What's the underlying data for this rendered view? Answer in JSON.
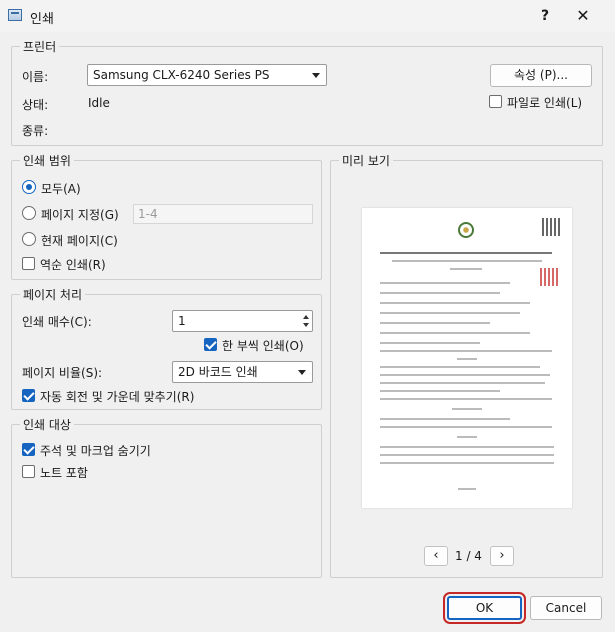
{
  "window": {
    "title": "인쇄",
    "help": "?",
    "close": "✕"
  },
  "printer": {
    "legend": "프린터",
    "name_label": "이름:",
    "name_value": "Samsung CLX-6240 Series PS",
    "status_label": "상태:",
    "status_value": "Idle",
    "type_label": "종류:",
    "properties_button": "속성 (P)...",
    "print_to_file": "파일로 인쇄(L)",
    "print_to_file_checked": false
  },
  "range": {
    "legend": "인쇄 범위",
    "all": "모두(A)",
    "pages": "페이지 지정(G)",
    "pages_placeholder": "1-4",
    "current": "현재 페이지(C)",
    "reverse": "역순 인쇄(R)",
    "selected": "all"
  },
  "handling": {
    "legend": "페이지 처리",
    "copies_label": "인쇄 매수(C):",
    "copies_value": "1",
    "collate": "한 부씩 인쇄(O)",
    "collate_checked": true,
    "scale_label": "페이지 비율(S):",
    "scale_value": "2D 바코드 인쇄",
    "autorotate": "자동 회전 및 가운데 맞추기(R)",
    "autorotate_checked": true
  },
  "target": {
    "legend": "인쇄 대상",
    "hide_annotations": "주석 및 마크업 숨기기",
    "hide_annotations_checked": true,
    "include_notes": "노트 포함",
    "include_notes_checked": false
  },
  "preview": {
    "legend": "미리 보기",
    "page_indicator": "1 / 4",
    "prev": "‹",
    "next": "›"
  },
  "buttons": {
    "ok": "OK",
    "cancel": "Cancel"
  },
  "colors": {
    "accent": "#1565c0",
    "highlight": "#c62828"
  }
}
